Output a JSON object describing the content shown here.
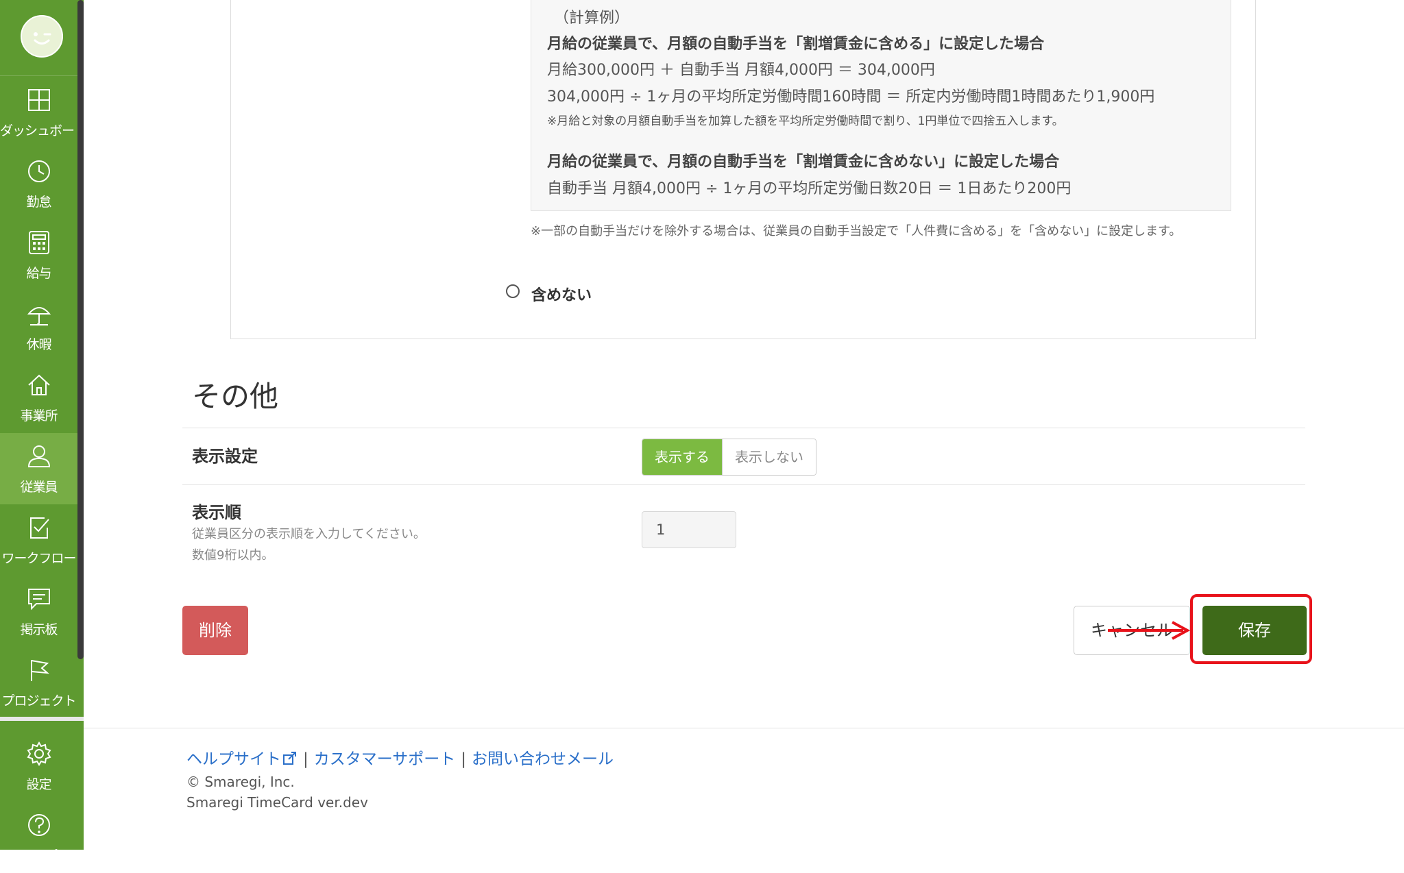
{
  "sidebar": {
    "items": [
      {
        "label": "ダッシュボード",
        "icon": "dashboard-icon"
      },
      {
        "label": "勤怠",
        "icon": "clock-icon"
      },
      {
        "label": "給与",
        "icon": "calculator-icon"
      },
      {
        "label": "休暇",
        "icon": "umbrella-icon"
      },
      {
        "label": "事業所",
        "icon": "home-icon"
      },
      {
        "label": "従業員",
        "icon": "user-icon",
        "active": true
      },
      {
        "label": "ワークフロー",
        "icon": "workflow-icon"
      },
      {
        "label": "掲示板",
        "icon": "message-board-icon"
      },
      {
        "label": "プロジェクト",
        "icon": "flag-icon"
      }
    ],
    "lower_items": [
      {
        "label": "設定",
        "icon": "gear-icon"
      },
      {
        "label": "ヘルプ",
        "icon": "help-icon"
      }
    ]
  },
  "example": {
    "heading": "（計算例）",
    "case1_title": "月給の従業員で、月額の自動手当を「割増賃金に含める」に設定した場合",
    "case1_line1": "月給300,000円 ＋ 自動手当 月額4,000円 ＝ 304,000円",
    "case1_line2": "304,000円 ÷ 1ヶ月の平均所定労働時間160時間 ＝ 所定内労働時間1時間あたり1,900円",
    "case1_note": "※月給と対象の月額自動手当を加算した額を平均所定労働時間で割り、1円単位で四捨五入します。",
    "case2_title": "月給の従業員で、月額の自動手当を「割増賃金に含めない」に設定した場合",
    "case2_line1": "自動手当 月額4,000円 ÷ 1ヶ月の平均所定労働日数20日 ＝ 1日あたり200円"
  },
  "note": "※一部の自動手当だけを除外する場合は、従業員の自動手当設定で「人件費に含める」を「含めない」に設定します。",
  "radio_exclude_label": "含めない",
  "other": {
    "title": "その他",
    "display_setting": {
      "label": "表示設定",
      "option_show": "表示する",
      "option_hide": "表示しない",
      "selected": "表示する"
    },
    "display_order": {
      "label": "表示順",
      "help1": "従業員区分の表示順を入力してください。",
      "help2": "数値9桁以内。",
      "value": "1"
    }
  },
  "buttons": {
    "delete": "削除",
    "cancel": "キャンセル",
    "save": "保存"
  },
  "footer": {
    "help_site": "ヘルプサイト",
    "customer_support": "カスタマーサポート",
    "contact_mail": "お問い合わせメール",
    "separator": "|",
    "copyright": "© Smaregi, Inc.",
    "version": "Smaregi TimeCard ver.dev"
  },
  "colors": {
    "sidebar": "#5e9a30",
    "sidebar_active": "#77ad45",
    "toggle_on": "#7cba41",
    "save_button": "#3e6a19",
    "delete_button": "#d35a5a",
    "annotation_red": "#e8121a",
    "link": "#2a6fc9"
  }
}
